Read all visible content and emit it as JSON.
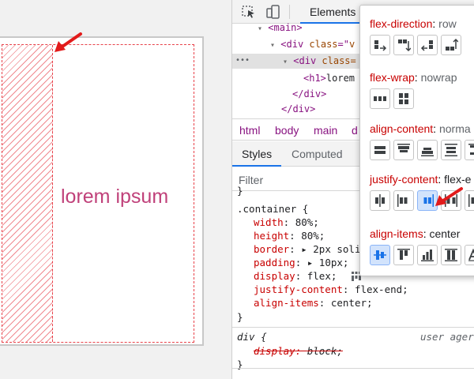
{
  "preview": {
    "text": "lorem ipsum"
  },
  "devtools": {
    "toolbar": {
      "active_tab": "Elements"
    },
    "dom_tree": {
      "lines": [
        {
          "indent": "▾",
          "open": "<main>",
          "rest": ""
        },
        {
          "indent": "▾",
          "open": "<div class=\"",
          "rest": "v"
        },
        {
          "indent": "▾",
          "open": "<div class=",
          "rest": ""
        },
        {
          "indent": "",
          "open": "<h1>",
          "rest": "lorem"
        },
        {
          "indent": "",
          "open": "</div>",
          "rest": ""
        },
        {
          "indent": "",
          "open": "</div>",
          "rest": ""
        }
      ],
      "ellipsis": "•••"
    },
    "breadcrumbs": [
      "html",
      "body",
      "main",
      "d"
    ],
    "styles_tabs": {
      "styles": "Styles",
      "computed": "Computed"
    },
    "filter": {
      "placeholder": "Filter"
    },
    "rules": {
      "top_brace": "}",
      "container_selector": ".container {",
      "declarations": [
        {
          "prop": "width",
          "value": "80%;"
        },
        {
          "prop": "height",
          "value": "80%;"
        },
        {
          "prop": "border",
          "value": "▸ 2px soli"
        },
        {
          "prop": "padding",
          "value": "▸ 10px;"
        },
        {
          "prop": "display",
          "value": "flex;"
        },
        {
          "prop": "justify-content",
          "value": "flex-end;"
        },
        {
          "prop": "align-items",
          "value": "center;"
        }
      ],
      "close_brace": "}",
      "div_selector": "div {",
      "user_agent": "user ager",
      "div_decl_prop": "display",
      "div_decl_value": "block;",
      "div_close": "}"
    },
    "flex_editor": {
      "sections": [
        {
          "key": "flex-direction",
          "value": "row",
          "value_dark": false,
          "buttons": 4,
          "active": -1
        },
        {
          "key": "flex-wrap",
          "value": "nowrap",
          "value_dark": false,
          "buttons": 2,
          "active": -1
        },
        {
          "key": "align-content",
          "value": "norma",
          "value_dark": false,
          "buttons": 5,
          "active": -1
        },
        {
          "key": "justify-content",
          "value": "flex-e",
          "value_dark": true,
          "buttons": 5,
          "active": 2
        },
        {
          "key": "align-items",
          "value": "center",
          "value_dark": true,
          "buttons": 5,
          "active": 0
        }
      ]
    }
  },
  "colors": {
    "highlight_red": "#e8424a",
    "text_magenta": "#c0417a",
    "accent_blue": "#1a73e8",
    "active_button_bg": "#d2e3fc"
  }
}
